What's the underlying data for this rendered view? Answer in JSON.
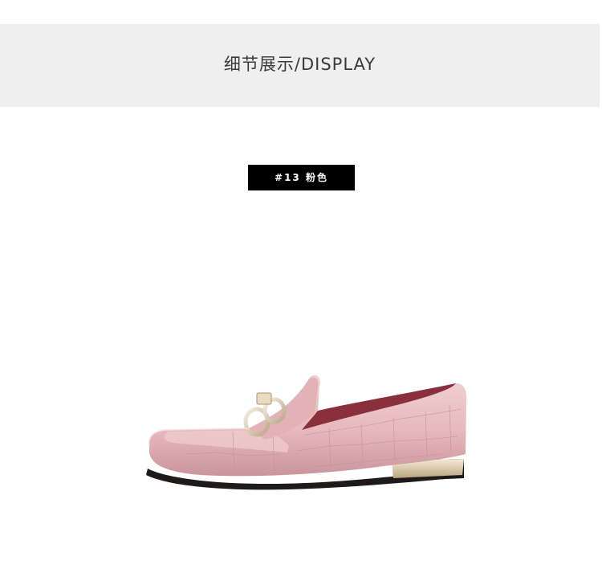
{
  "header": {
    "title": "细节展示/DISPLAY"
  },
  "product": {
    "color_tag": "#13  粉色",
    "image_icon": "pink-croc-loafer-shoe",
    "colors": {
      "leather": "#e8bfc2",
      "leather_shadow": "#c9959b",
      "lining": "#8a2f3c",
      "hardware": "#d8c9a8",
      "sole": "#1e1a1a"
    }
  }
}
